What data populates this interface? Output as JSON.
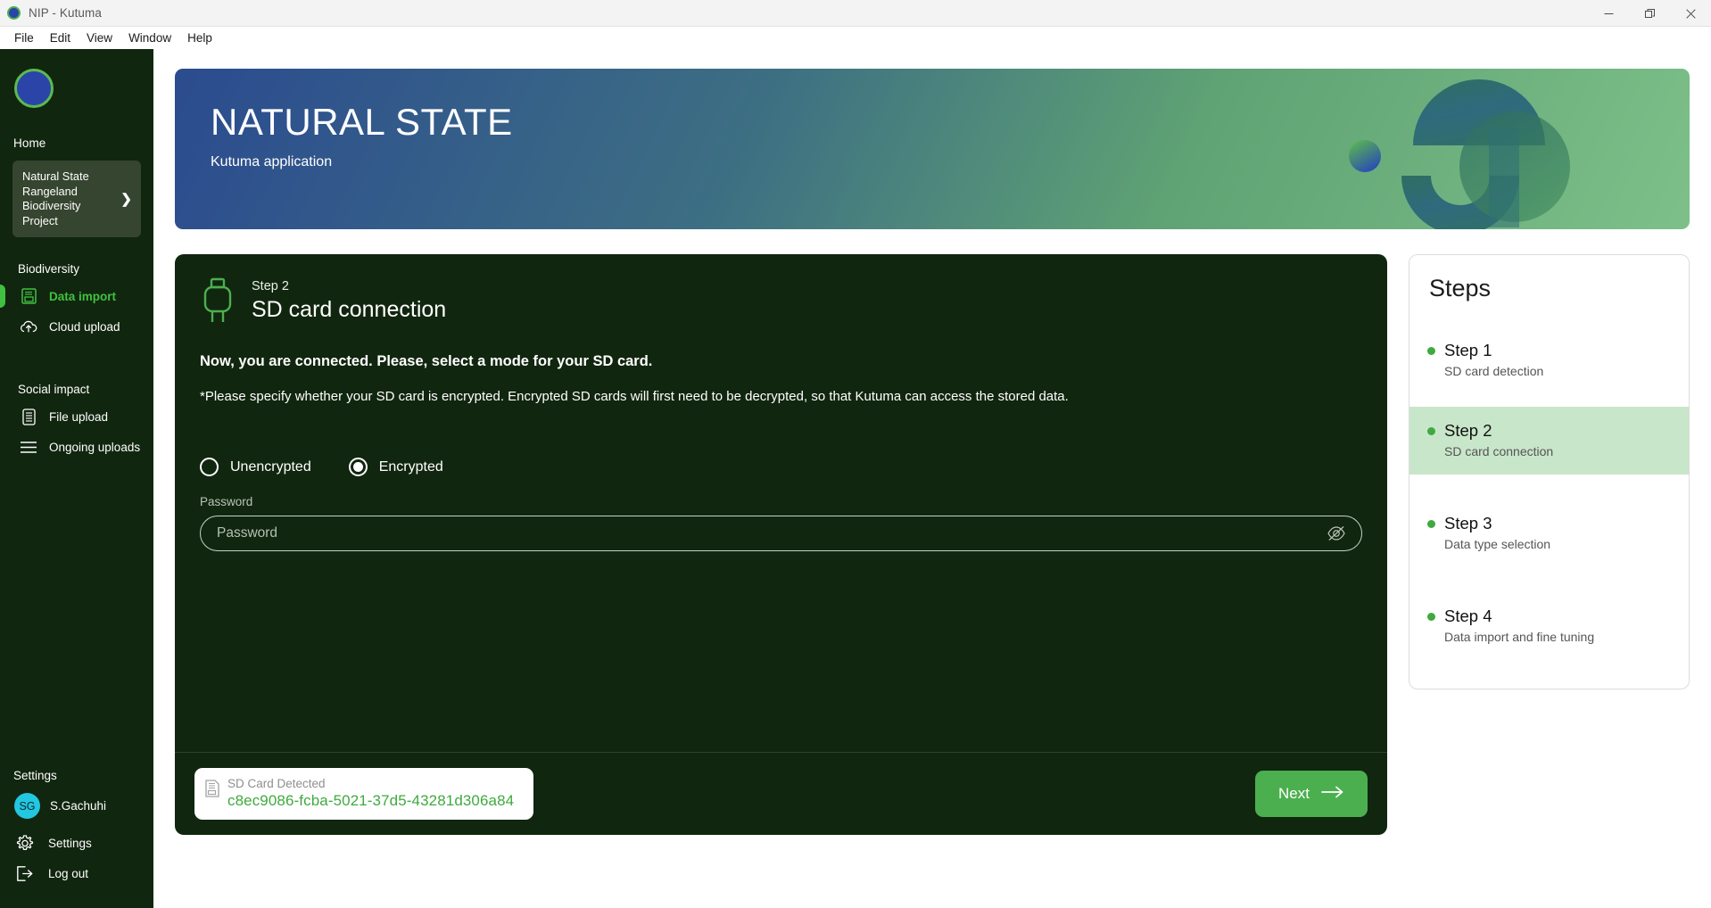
{
  "window": {
    "title": "NIP - Kutuma",
    "logo_icon": "app-logo-circle",
    "controls": {
      "minimize": "minimize-icon",
      "restore": "restore-icon",
      "close": "close-icon"
    }
  },
  "menubar": {
    "items": [
      {
        "label": "File"
      },
      {
        "label": "Edit"
      },
      {
        "label": "View"
      },
      {
        "label": "Window"
      },
      {
        "label": "Help"
      }
    ]
  },
  "sidebar": {
    "brand_badge_icon": "brand-circle-icon",
    "home_label": "Home",
    "project": {
      "name": "Natural State Rangeland Biodiversity Project",
      "chevron": "❯"
    },
    "groups": [
      {
        "label": "Biodiversity",
        "items": [
          {
            "label": "Data import",
            "icon": "floppy-disk-icon",
            "active": true
          },
          {
            "label": "Cloud upload",
            "icon": "cloud-upload-icon",
            "active": false
          }
        ]
      },
      {
        "label": "Social impact",
        "items": [
          {
            "label": "File upload",
            "icon": "file-upload-icon",
            "active": false
          },
          {
            "label": "Ongoing uploads",
            "icon": "list-lines-icon",
            "active": false
          }
        ]
      }
    ],
    "settings_label": "Settings",
    "user": {
      "initials": "SG",
      "name": "S.Gachuhi"
    },
    "settings_item": {
      "label": "Settings",
      "icon": "gear-icon"
    },
    "logout_item": {
      "label": "Log out",
      "icon": "logout-arrow-icon"
    }
  },
  "banner": {
    "title": "NATURAL STATE",
    "subtitle": "Kutuma application",
    "artwork_icon": "natural-state-logo-mark"
  },
  "step_card": {
    "icon": "sd-card-plug-icon",
    "eyebrow": "Step 2",
    "title": "SD card connection",
    "lead": "Now, you are connected. Please, select a mode for your SD card.",
    "note": "*Please specify whether your SD card is encrypted. Encrypted SD cards will first need to be decrypted, so that Kutuma can access the stored data.",
    "radios": [
      {
        "label": "Unencrypted",
        "checked": false
      },
      {
        "label": "Encrypted",
        "checked": true
      }
    ],
    "password": {
      "label": "Password",
      "placeholder": "Password",
      "value": "",
      "toggle_icon": "eye-off-icon"
    },
    "footer": {
      "sd_chip": {
        "icon": "sd-card-icon",
        "label": "SD Card Detected",
        "value": "c8ec9086-fcba-5021-37d5-43281d306a84"
      },
      "next_button": {
        "label": "Next",
        "icon": "arrow-right-icon"
      }
    }
  },
  "steps_panel": {
    "title": "Steps",
    "steps": [
      {
        "title": "Step 1",
        "subtitle": "SD card detection",
        "active": false
      },
      {
        "title": "Step 2",
        "subtitle": "SD card connection",
        "active": true
      },
      {
        "title": "Step 3",
        "subtitle": "Data type selection",
        "active": false
      },
      {
        "title": "Step 4",
        "subtitle": "Data import and fine tuning",
        "active": false
      }
    ]
  },
  "colors": {
    "sidebar_bg": "#11260f",
    "card_bg": "#11260f",
    "accent_green": "#41c141",
    "button_green": "#4caf4f",
    "active_step_bg": "#c8e6c9",
    "avatar_cyan": "#22c7e0",
    "sd_value_green": "#3faa3f"
  }
}
